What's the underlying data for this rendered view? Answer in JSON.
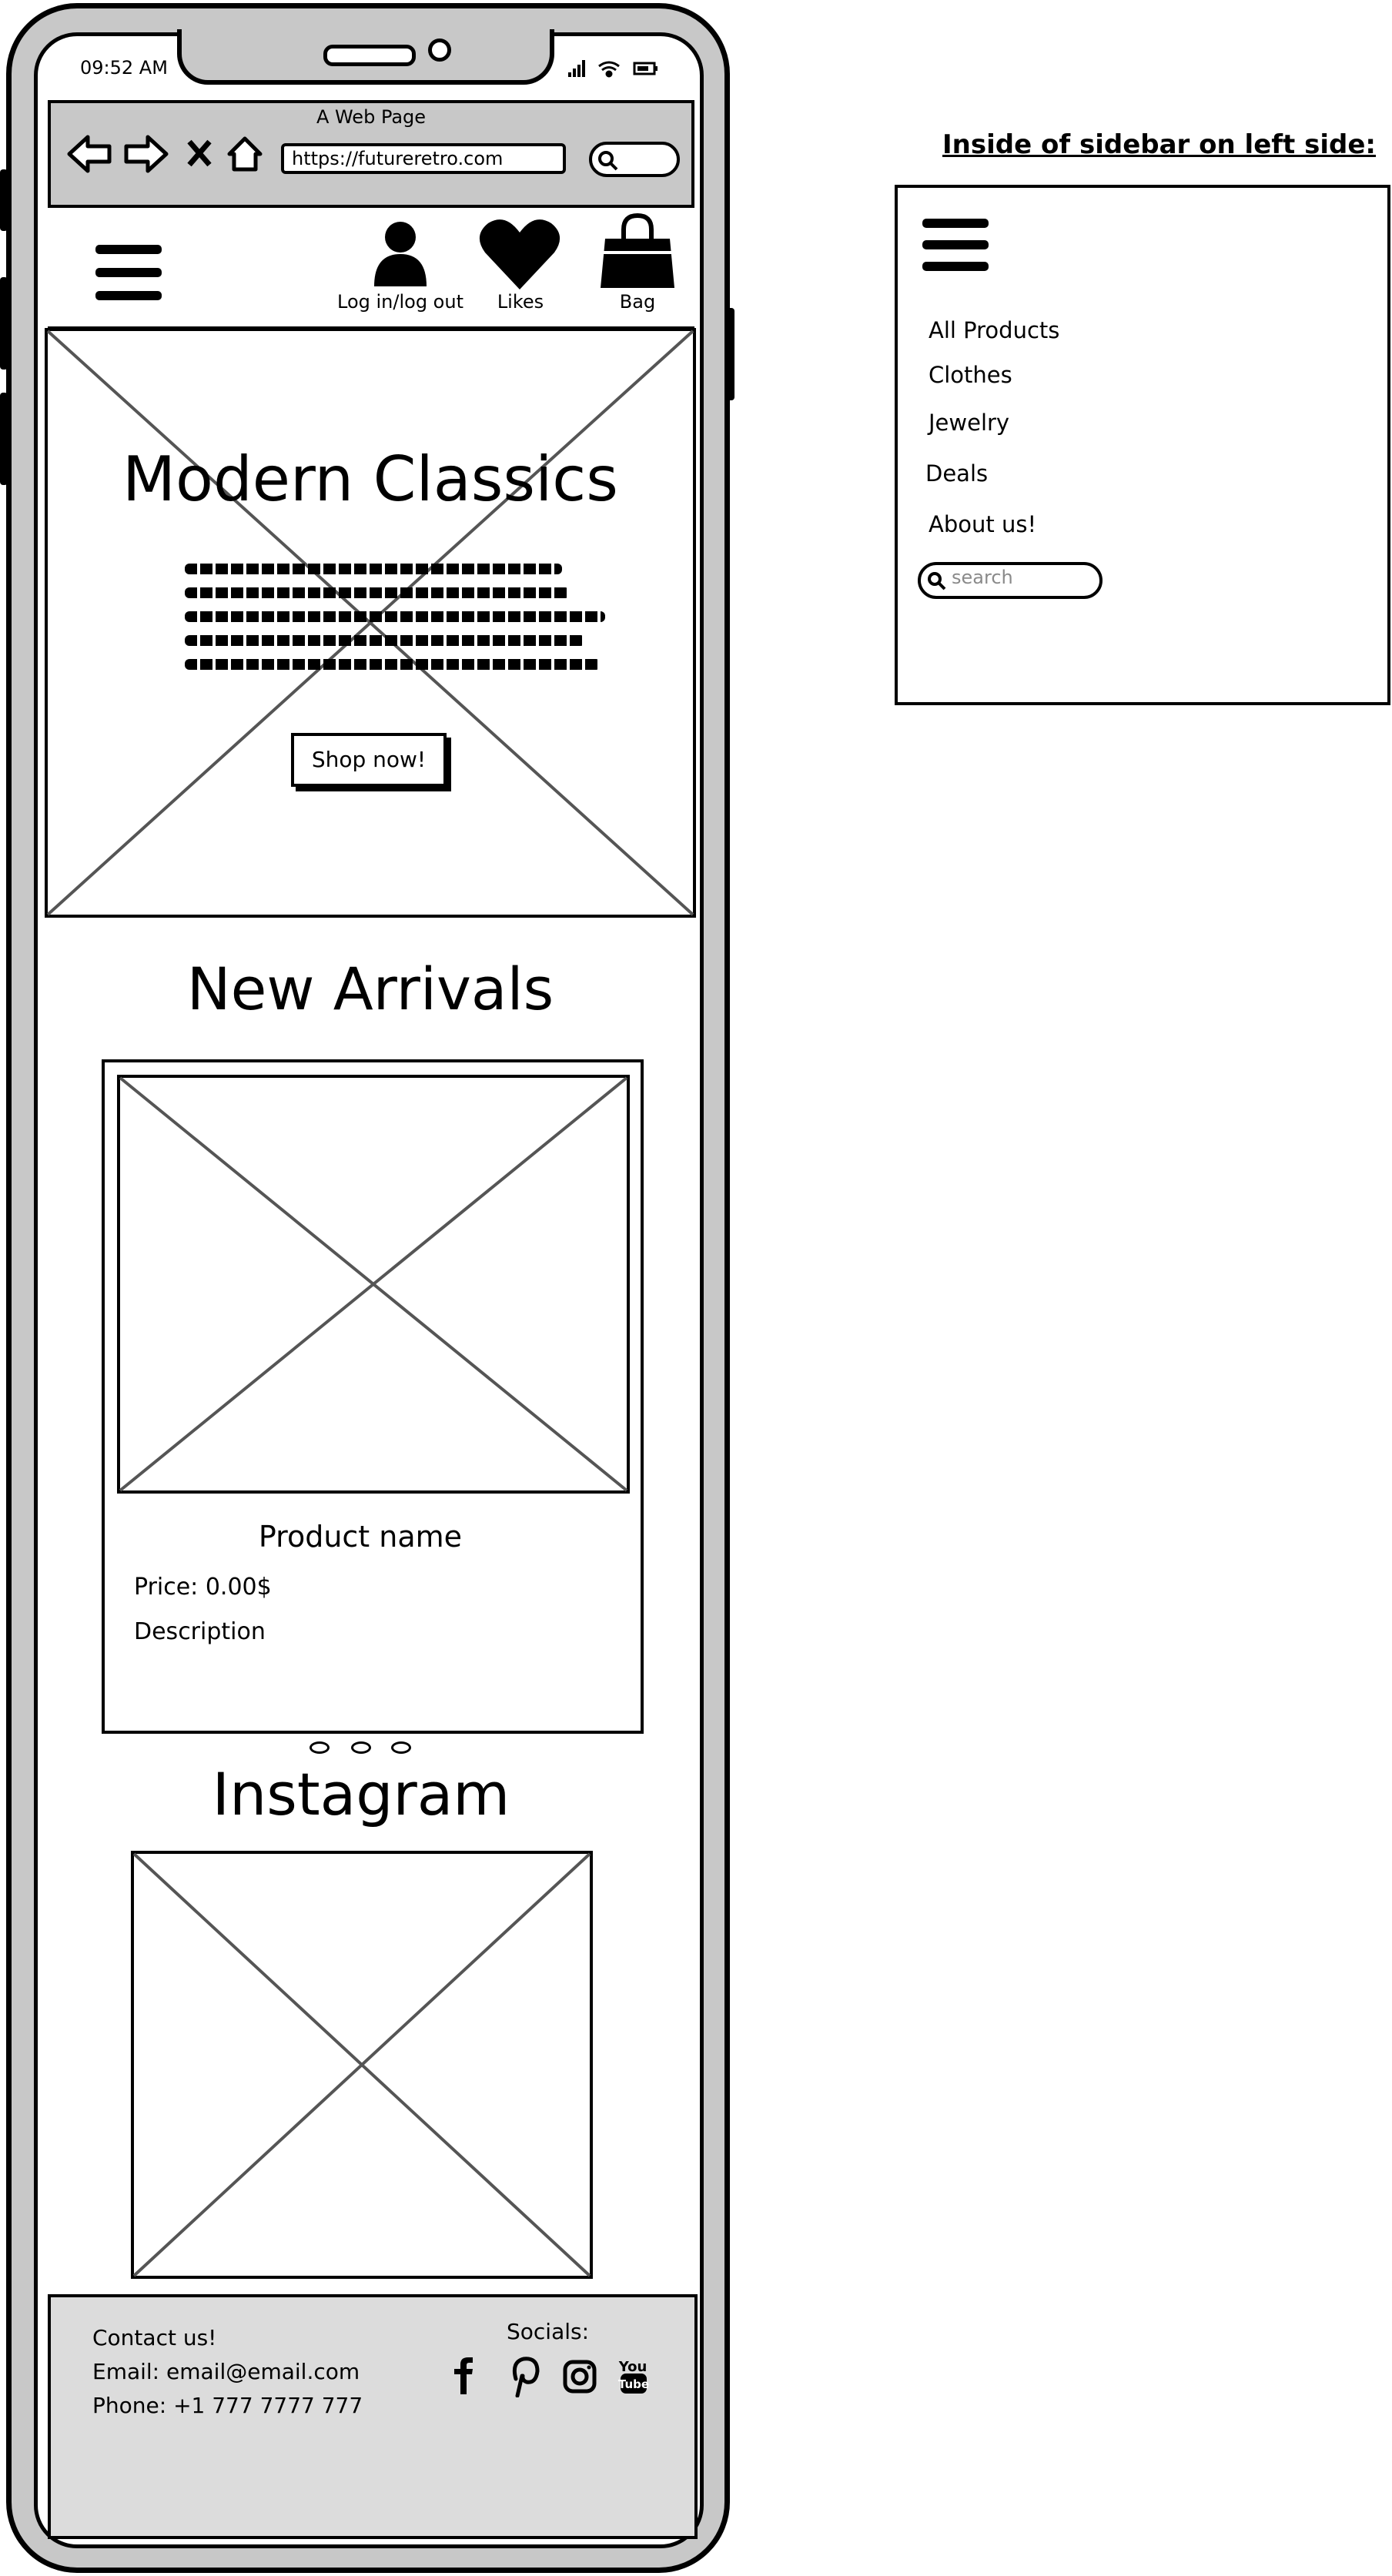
{
  "status_bar": {
    "time": "09:52 AM"
  },
  "browser": {
    "title": "A Web Page",
    "url": "https://futureretro.com"
  },
  "nav": {
    "account_label": "Log in/log out",
    "likes_label": "Likes",
    "bag_label": "Bag"
  },
  "hero": {
    "title": "Modern Classics",
    "cta_label": "Shop now!"
  },
  "new_arrivals": {
    "title": "New Arrivals",
    "product": {
      "name": "Product name",
      "price": "Price: 0.00$",
      "description": "Description"
    },
    "carousel_dots": 3
  },
  "instagram": {
    "title": "Instagram"
  },
  "footer": {
    "contact_heading": "Contact us!",
    "email": "Email: email@email.com",
    "phone": "Phone: +1 777 7777 777",
    "socials_heading": "Socials:",
    "social_icons": [
      "facebook-icon",
      "pinterest-icon",
      "instagram-icon",
      "youtube-icon"
    ]
  },
  "sidebar_preview": {
    "heading": "Inside of sidebar on left side:",
    "items": [
      {
        "label": "All Products"
      },
      {
        "label": "Clothes"
      },
      {
        "label": "Jewelry"
      },
      {
        "label": "Deals"
      },
      {
        "label": "About us!"
      }
    ],
    "search_placeholder": "search"
  },
  "colors": {
    "frame_gray": "#c8c8c8",
    "footer_gray": "#dcdcdc",
    "ink": "#000000"
  }
}
